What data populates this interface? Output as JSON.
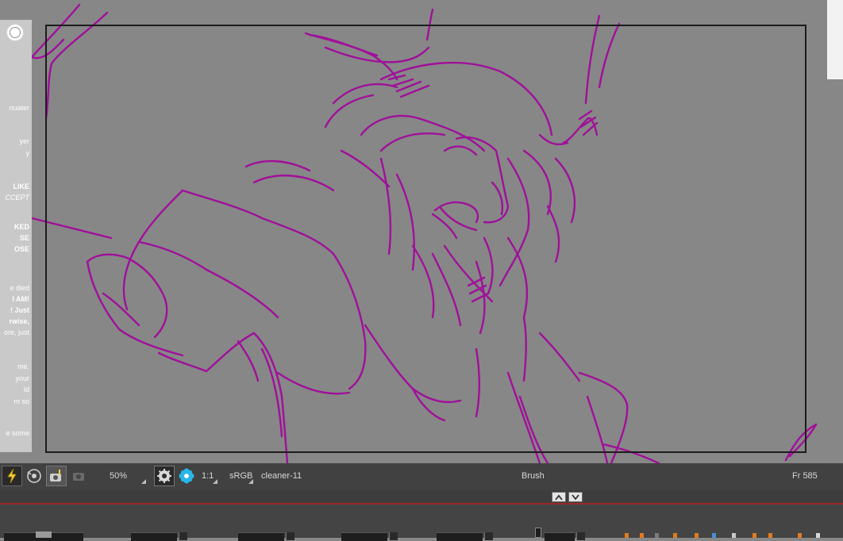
{
  "side_panel": {
    "lines": [
      {
        "text": "nuater",
        "style": "normal"
      },
      {
        "text": "yer",
        "style": "normal"
      },
      {
        "text": "y",
        "style": "normal"
      },
      {
        "text": "LIKE",
        "style": "bold"
      },
      {
        "text": "CCEPT",
        "style": "italic"
      },
      {
        "text": "KED",
        "style": "bold"
      },
      {
        "text": "SE",
        "style": "bold"
      },
      {
        "text": "OSE",
        "style": "bold"
      },
      {
        "text": "e died",
        "style": "normal"
      },
      {
        "text": "I AM!",
        "style": "bold"
      },
      {
        "text": "! Just",
        "style": "bold"
      },
      {
        "text": "rwise,",
        "style": "bold"
      },
      {
        "text": "ore, just",
        "style": "normal"
      },
      {
        "text": "me.",
        "style": "normal"
      },
      {
        "text": "your",
        "style": "normal"
      },
      {
        "text": "ld",
        "style": "normal"
      },
      {
        "text": "m so",
        "style": "normal"
      },
      {
        "text": "e some",
        "style": "normal"
      }
    ]
  },
  "status_bar": {
    "zoom": "50%",
    "ratio": "1:1",
    "color_space": "sRGB",
    "layer_name": "cleaner-11",
    "active_tool": "Brush",
    "frame": "Fr 585"
  },
  "colors": {
    "canvas_bg": "#878787",
    "sketch_stroke": "#a0109a",
    "status_bar_bg": "#414141",
    "accent_red": "#9b2727"
  },
  "icons": {
    "lightning": "lightning-icon",
    "onion_skin": "onion-skin-icon",
    "camera": "camera-icon",
    "gear": "gear-icon",
    "flower": "flower-icon",
    "arrow_up": "chevron-up-icon",
    "arrow_down": "chevron-down-icon"
  }
}
